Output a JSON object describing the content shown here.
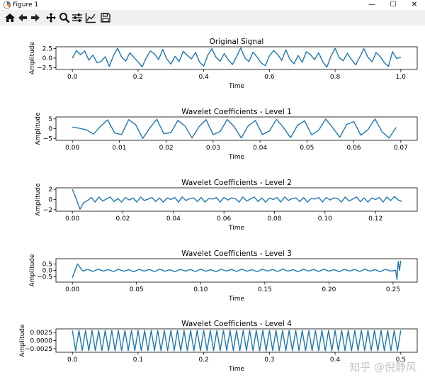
{
  "window": {
    "title": "Figure 1",
    "controls": {
      "minimize": "—",
      "maximize": "☐",
      "close": "✕"
    }
  },
  "toolbar": {
    "buttons": [
      {
        "name": "home-icon",
        "label": "Home"
      },
      {
        "name": "back-icon",
        "label": "Back"
      },
      {
        "name": "forward-icon",
        "label": "Forward"
      },
      {
        "name": "pan-icon",
        "label": "Pan"
      },
      {
        "name": "zoom-icon",
        "label": "Zoom"
      },
      {
        "name": "configure-subplots-icon",
        "label": "Subplots"
      },
      {
        "name": "edit-axis-icon",
        "label": "Customize"
      },
      {
        "name": "save-icon",
        "label": "Save"
      }
    ]
  },
  "watermark": "知乎 @倪静风",
  "colors": {
    "line": "#1f77b4"
  },
  "chart_data": [
    {
      "type": "line",
      "title": "Original Signal",
      "xlabel": "Time",
      "ylabel": "Amplitude",
      "xlim": [
        -0.05,
        1.05
      ],
      "ylim": [
        -3.0,
        3.0
      ],
      "xticks": [
        0.0,
        0.2,
        0.4,
        0.6,
        0.8,
        1.0
      ],
      "xticklabels": [
        "0.0",
        "0.2",
        "0.4",
        "0.6",
        "0.8",
        "1.0"
      ],
      "yticks": [
        -2.5,
        0.0,
        2.5
      ],
      "yticklabels": [
        "−2.5",
        "0.0",
        "2.5"
      ],
      "x": [
        0,
        0.0125,
        0.025,
        0.0375,
        0.05,
        0.0625,
        0.075,
        0.0875,
        0.1,
        0.1125,
        0.125,
        0.1375,
        0.15,
        0.1625,
        0.175,
        0.1875,
        0.2,
        0.2125,
        0.225,
        0.2375,
        0.25,
        0.2625,
        0.275,
        0.2875,
        0.3,
        0.3125,
        0.325,
        0.3375,
        0.35,
        0.3625,
        0.375,
        0.3875,
        0.4,
        0.4125,
        0.425,
        0.4375,
        0.45,
        0.4625,
        0.475,
        0.4875,
        0.5,
        0.5125,
        0.525,
        0.5375,
        0.55,
        0.5625,
        0.575,
        0.5875,
        0.6,
        0.6125,
        0.625,
        0.6375,
        0.65,
        0.6625,
        0.675,
        0.6875,
        0.7,
        0.7125,
        0.725,
        0.7375,
        0.75,
        0.7625,
        0.775,
        0.7875,
        0.8,
        0.8125,
        0.825,
        0.8375,
        0.85,
        0.8625,
        0.875,
        0.8875,
        0.9,
        0.9125,
        0.925,
        0.9375,
        0.95,
        0.9625,
        0.975,
        0.9875,
        1.0
      ],
      "y": [
        0.0,
        2.0,
        0.9,
        1.9,
        -0.5,
        0.8,
        -1.2,
        -0.9,
        0.4,
        -2.2,
        0.6,
        2.6,
        0.3,
        -0.8,
        1.4,
        0.2,
        -1.0,
        -2.3,
        0.1,
        1.9,
        1.1,
        -0.4,
        2.3,
        -0.2,
        -1.6,
        0.5,
        -0.9,
        1.8,
        0.7,
        -0.2,
        1.5,
        -1.1,
        -2.1,
        0.8,
        2.5,
        0.2,
        -0.8,
        1.2,
        -0.5,
        -1.7,
        0.4,
        2.7,
        0.1,
        -0.9,
        1.6,
        0.3,
        -1.3,
        -2.0,
        0.6,
        2.0,
        1.0,
        -0.6,
        2.2,
        -0.3,
        -1.5,
        0.7,
        -1.1,
        1.7,
        0.9,
        -0.4,
        1.4,
        -1.0,
        -2.4,
        0.5,
        2.6,
        0.1,
        -0.7,
        1.3,
        -0.4,
        -1.8,
        0.3,
        2.5,
        0.2,
        -1.0,
        1.5,
        0.4,
        -1.2,
        -2.2,
        1.7,
        -0.1,
        0.2
      ]
    },
    {
      "type": "line",
      "title": "Wavelet Coefficients - Level 1",
      "xlabel": "Time",
      "ylabel": "Amplitude",
      "xlim": [
        -0.0035,
        0.0735
      ],
      "ylim": [
        -6.0,
        6.0
      ],
      "xticks": [
        0.0,
        0.01,
        0.02,
        0.03,
        0.04,
        0.05,
        0.06,
        0.07
      ],
      "xticklabels": [
        "0.00",
        "0.01",
        "0.02",
        "0.03",
        "0.04",
        "0.05",
        "0.06",
        "0.07"
      ],
      "yticks": [
        -5,
        0,
        5
      ],
      "yticklabels": [
        "−5",
        "0",
        "5"
      ],
      "x": [
        0,
        0.0015,
        0.003,
        0.0045,
        0.006,
        0.0075,
        0.009,
        0.0105,
        0.012,
        0.0135,
        0.015,
        0.0165,
        0.018,
        0.0195,
        0.021,
        0.0225,
        0.024,
        0.0255,
        0.027,
        0.0285,
        0.03,
        0.0315,
        0.033,
        0.0345,
        0.036,
        0.0375,
        0.039,
        0.0405,
        0.042,
        0.0435,
        0.045,
        0.0465,
        0.048,
        0.0495,
        0.051,
        0.0525,
        0.054,
        0.0555,
        0.057,
        0.0585,
        0.06,
        0.0615,
        0.063,
        0.0645,
        0.066,
        0.0675,
        0.069
      ],
      "y": [
        0.8,
        0.2,
        -0.6,
        -2.8,
        1.2,
        4.5,
        -2.2,
        -3.0,
        4.6,
        2.0,
        -5.0,
        0.3,
        4.8,
        -2.6,
        -2.0,
        4.2,
        1.4,
        -4.8,
        1.0,
        4.6,
        -3.0,
        -1.5,
        4.7,
        1.0,
        -4.8,
        1.5,
        4.2,
        -3.0,
        -1.2,
        4.8,
        0.6,
        -4.6,
        1.8,
        4.0,
        -3.2,
        -0.8,
        4.9,
        0.4,
        -4.4,
        2.2,
        3.6,
        -3.4,
        -0.5,
        5.0,
        -1.6,
        -4.8,
        0.6
      ]
    },
    {
      "type": "line",
      "title": "Wavelet Coefficients - Level 2",
      "xlabel": "Time",
      "ylabel": "Amplitude",
      "xlim": [
        -0.0065,
        0.1365
      ],
      "ylim": [
        -2.3,
        2.3
      ],
      "xticks": [
        0.0,
        0.02,
        0.04,
        0.06,
        0.08,
        0.1,
        0.12
      ],
      "xticklabels": [
        "0.00",
        "0.02",
        "0.04",
        "0.06",
        "0.08",
        "0.10",
        "0.12"
      ],
      "yticks": [
        -2,
        0,
        2
      ],
      "yticklabels": [
        "−2",
        "0",
        "2"
      ],
      "x": [
        0,
        0.0015,
        0.003,
        0.0045,
        0.006,
        0.0075,
        0.009,
        0.0105,
        0.012,
        0.0135,
        0.015,
        0.0165,
        0.018,
        0.0195,
        0.021,
        0.0225,
        0.024,
        0.0255,
        0.027,
        0.0285,
        0.03,
        0.0315,
        0.033,
        0.0345,
        0.036,
        0.0375,
        0.039,
        0.0405,
        0.042,
        0.0435,
        0.045,
        0.0465,
        0.048,
        0.0495,
        0.051,
        0.0525,
        0.054,
        0.0555,
        0.057,
        0.0585,
        0.06,
        0.0615,
        0.063,
        0.0645,
        0.066,
        0.0675,
        0.069,
        0.0705,
        0.072,
        0.0735,
        0.075,
        0.0765,
        0.078,
        0.0795,
        0.081,
        0.0825,
        0.084,
        0.0855,
        0.087,
        0.0885,
        0.09,
        0.0915,
        0.093,
        0.0945,
        0.096,
        0.0975,
        0.099,
        0.1005,
        0.102,
        0.1035,
        0.105,
        0.1065,
        0.108,
        0.1095,
        0.111,
        0.1125,
        0.114,
        0.1155,
        0.117,
        0.1185,
        0.12,
        0.1215,
        0.123,
        0.1245,
        0.126,
        0.1275,
        0.129,
        0.1305
      ],
      "y": [
        2.0,
        0.2,
        -1.9,
        -0.6,
        -0.2,
        0.4,
        -0.5,
        0.5,
        -0.3,
        0.1,
        0.5,
        -0.4,
        0.2,
        -0.5,
        0.4,
        -0.1,
        0.3,
        -0.5,
        0.5,
        -0.2,
        0.1,
        0.4,
        -0.4,
        0.3,
        -0.5,
        0.3,
        0.0,
        0.4,
        -0.5,
        0.5,
        -0.2,
        0.2,
        0.3,
        -0.4,
        0.4,
        -0.5,
        0.2,
        0.1,
        0.4,
        -0.5,
        0.4,
        -0.1,
        0.3,
        0.2,
        -0.5,
        0.5,
        -0.3,
        0.1,
        0.5,
        -0.4,
        0.3,
        -0.5,
        0.3,
        0.0,
        0.4,
        -0.5,
        0.5,
        -0.2,
        0.2,
        0.3,
        -0.4,
        0.4,
        -0.5,
        0.2,
        0.1,
        0.4,
        -0.5,
        0.4,
        -0.1,
        0.3,
        0.2,
        -0.5,
        0.5,
        -0.3,
        0.1,
        0.5,
        -0.4,
        0.3,
        -0.5,
        0.3,
        0.0,
        0.4,
        -0.5,
        0.5,
        -0.2,
        0.6,
        -0.1,
        -0.4
      ]
    },
    {
      "type": "line",
      "title": "Wavelet Coefficients - Level 3",
      "xlabel": "Time",
      "ylabel": "Amplitude",
      "xlim": [
        -0.0128,
        0.2688
      ],
      "ylim": [
        -0.9,
        0.9
      ],
      "xticks": [
        0.0,
        0.05,
        0.1,
        0.15,
        0.2,
        0.25
      ],
      "xticklabels": [
        "0.00",
        "0.05",
        "0.10",
        "0.15",
        "0.20",
        "0.25"
      ],
      "yticks": [
        -0.5,
        0.0,
        0.5
      ],
      "yticklabels": [
        "−0.5",
        "0.0",
        "0.5"
      ],
      "x": [
        0,
        0.004,
        0.008,
        0.012,
        0.016,
        0.02,
        0.024,
        0.028,
        0.032,
        0.036,
        0.04,
        0.044,
        0.048,
        0.052,
        0.056,
        0.06,
        0.064,
        0.068,
        0.072,
        0.076,
        0.08,
        0.084,
        0.088,
        0.092,
        0.096,
        0.1,
        0.104,
        0.108,
        0.112,
        0.116,
        0.12,
        0.124,
        0.128,
        0.132,
        0.136,
        0.14,
        0.144,
        0.148,
        0.152,
        0.156,
        0.16,
        0.164,
        0.168,
        0.172,
        0.176,
        0.18,
        0.184,
        0.188,
        0.192,
        0.196,
        0.2,
        0.204,
        0.208,
        0.212,
        0.216,
        0.22,
        0.224,
        0.228,
        0.232,
        0.236,
        0.24,
        0.244,
        0.248,
        0.252,
        0.253,
        0.254,
        0.255,
        0.256
      ],
      "y": [
        -0.55,
        0.5,
        -0.05,
        0.08,
        -0.08,
        0.1,
        -0.05,
        0.06,
        -0.09,
        0.09,
        -0.06,
        0.05,
        -0.1,
        0.08,
        -0.05,
        0.07,
        -0.09,
        0.1,
        -0.06,
        0.05,
        -0.1,
        0.08,
        -0.05,
        0.07,
        -0.09,
        0.1,
        -0.06,
        0.05,
        -0.1,
        0.09,
        -0.05,
        0.07,
        -0.08,
        0.1,
        -0.06,
        0.05,
        -0.1,
        0.09,
        -0.05,
        0.07,
        -0.08,
        0.1,
        -0.06,
        0.06,
        -0.1,
        0.09,
        -0.05,
        0.07,
        -0.08,
        0.1,
        -0.06,
        0.06,
        -0.1,
        0.09,
        -0.05,
        0.07,
        -0.08,
        0.1,
        -0.06,
        0.06,
        -0.1,
        0.09,
        -0.05,
        0.0,
        -0.7,
        0.7,
        0.0,
        0.75
      ]
    },
    {
      "type": "line",
      "title": "Wavelet Coefficients - Level 4",
      "xlabel": "Time",
      "ylabel": "Amplitude",
      "xlim": [
        -0.025,
        0.525
      ],
      "ylim": [
        -0.0036,
        0.0036
      ],
      "xticks": [
        0.0,
        0.1,
        0.2,
        0.3,
        0.4,
        0.5
      ],
      "xticklabels": [
        "0.0",
        "0.1",
        "0.2",
        "0.3",
        "0.4",
        "0.5"
      ],
      "yticks": [
        -0.0025,
        0.0,
        0.0025
      ],
      "yticklabels": [
        "−0.0025",
        "0.0000",
        "0.0025"
      ],
      "wave": {
        "amplitude": 0.0031,
        "cycles": 50,
        "x_end": 0.5
      }
    }
  ]
}
